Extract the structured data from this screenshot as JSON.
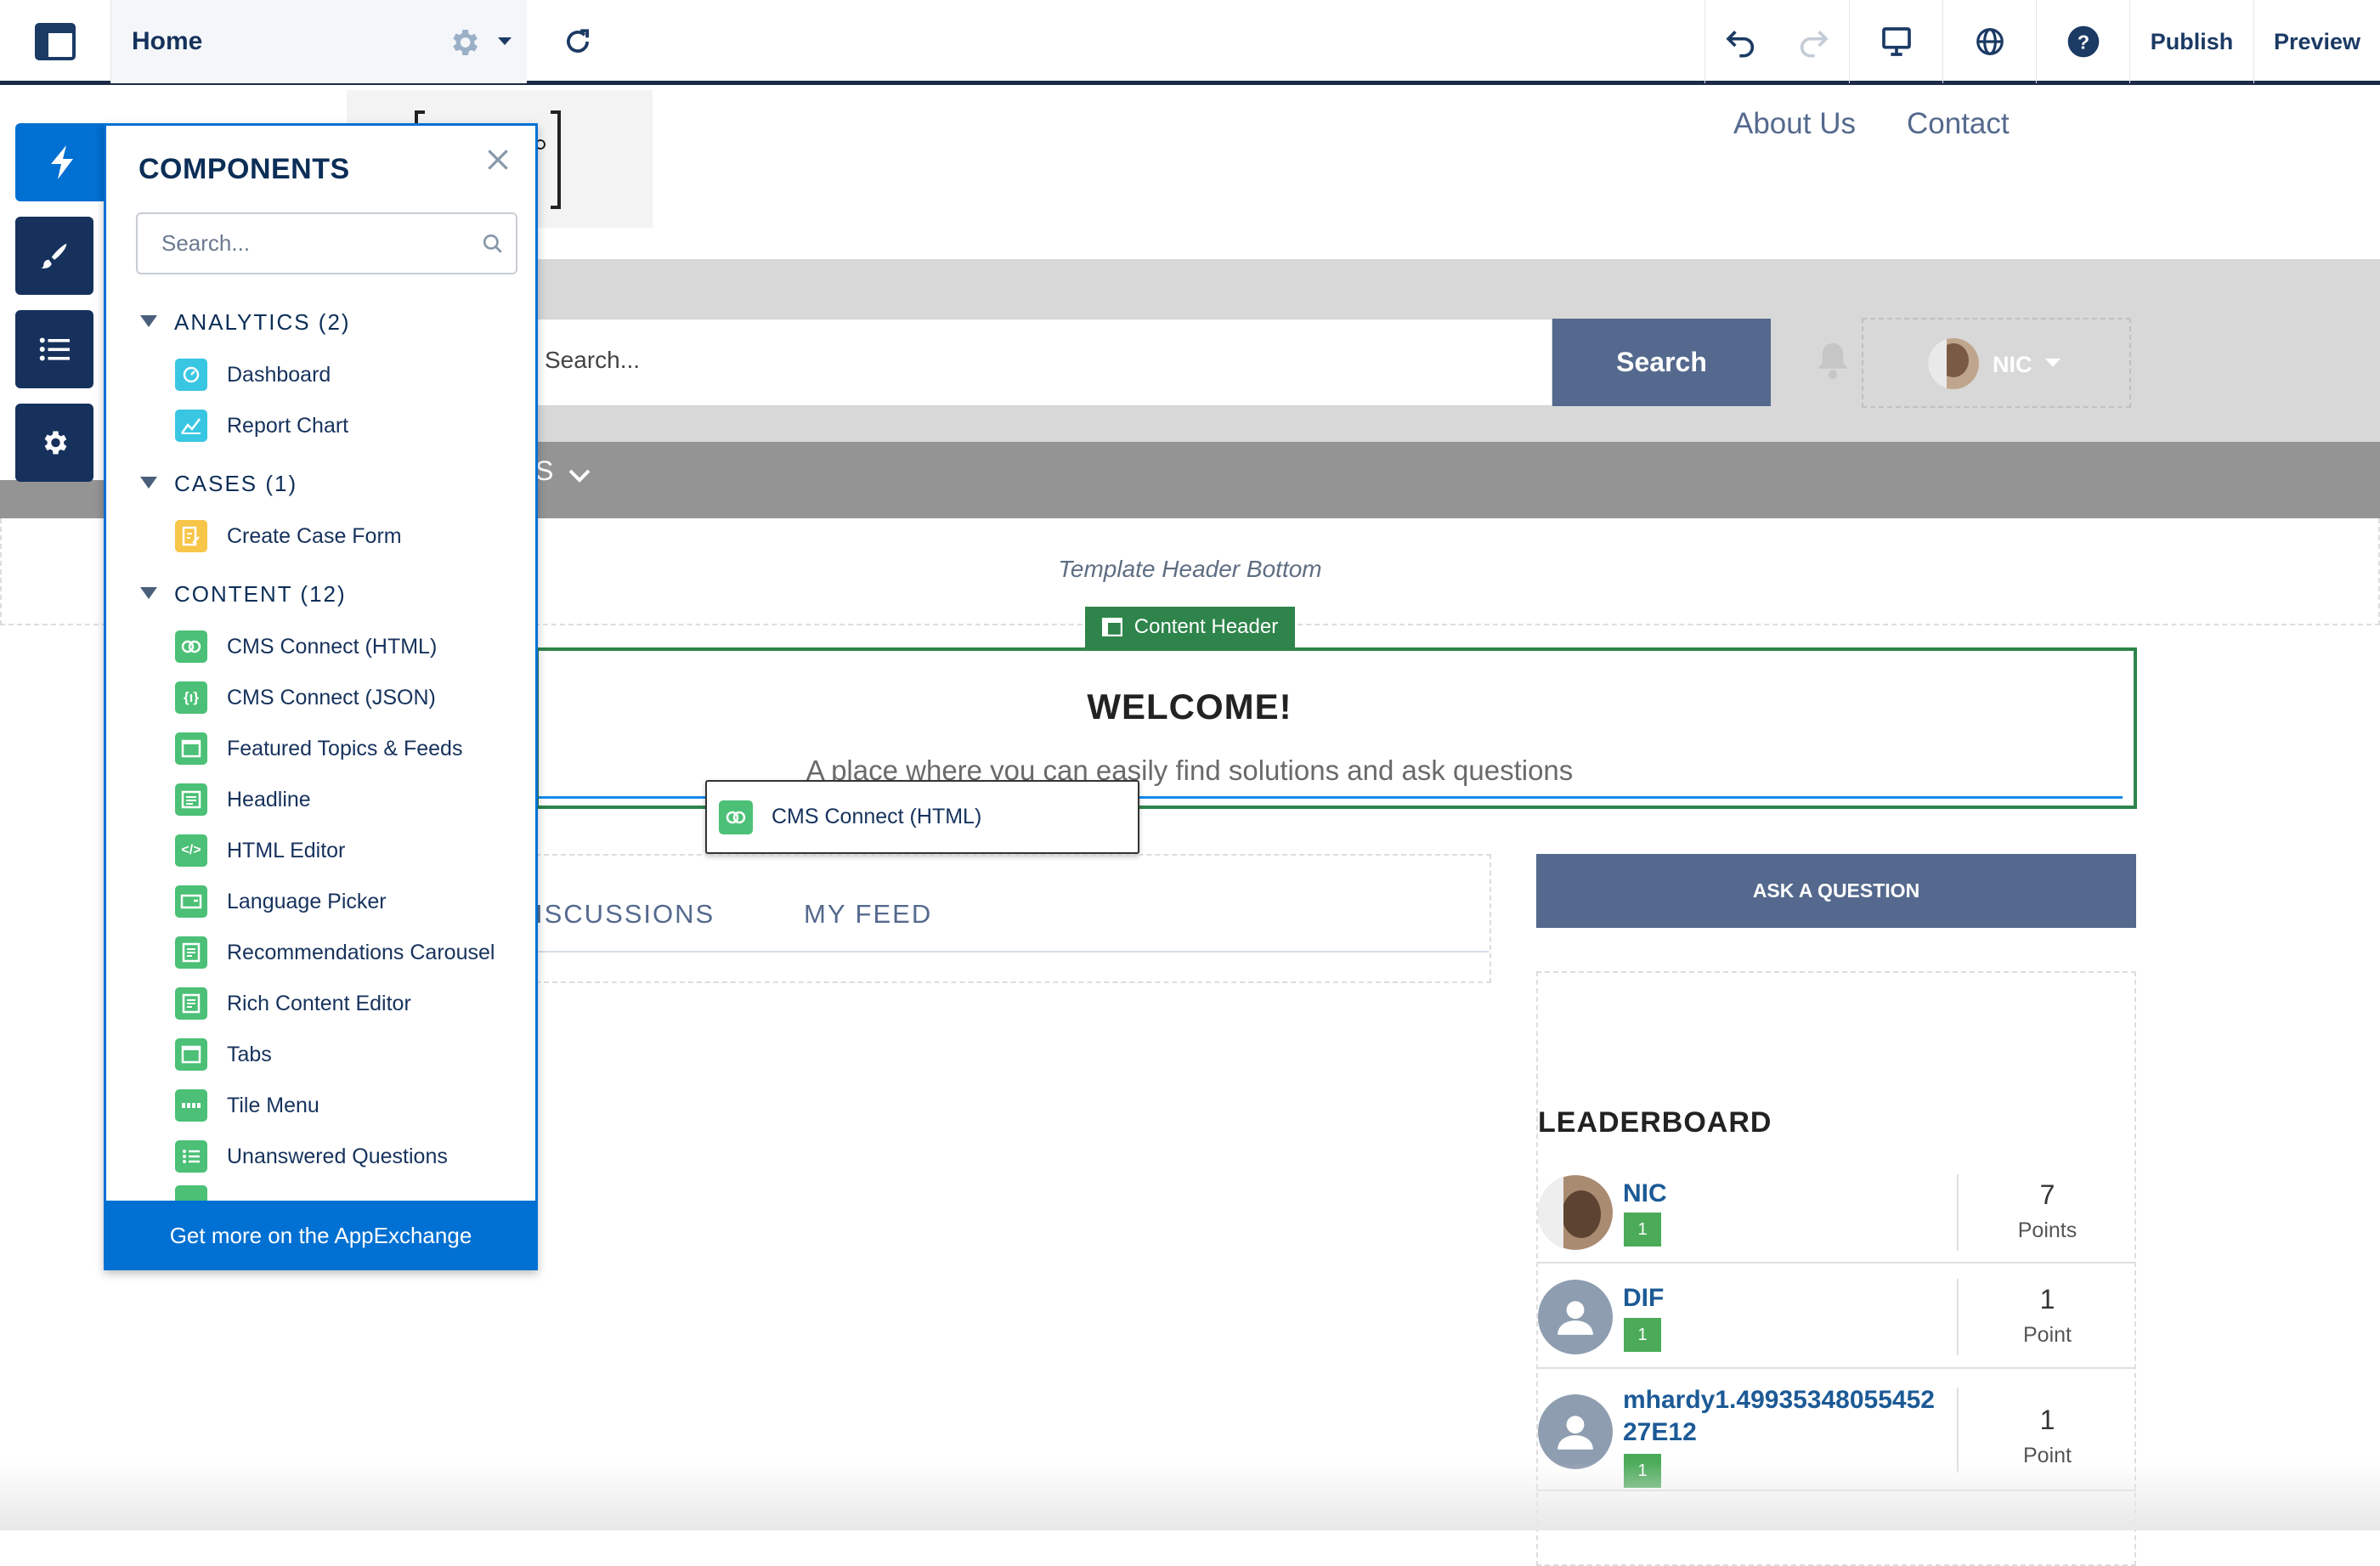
{
  "toolbar": {
    "page_name": "Home",
    "publish": "Publish",
    "preview": "Preview"
  },
  "site_nav": {
    "about": "About Us",
    "contact": "Contact"
  },
  "site_header": {
    "search_placeholder": "Search...",
    "search_button": "Search",
    "user_name": "NIC",
    "nav_partial": "S"
  },
  "template_header_bottom": "Template Header Bottom",
  "content_header": {
    "tag": "Content Header",
    "title": "WELCOME!",
    "subtitle": "A place where you can easily find solutions and ask questions"
  },
  "drag_item": "CMS Connect (HTML)",
  "tabs": {
    "discussions": "ISCUSSIONS",
    "my_feed": "MY FEED"
  },
  "ask_button": "ASK A QUESTION",
  "leaderboard": {
    "title": "LEADERBOARD",
    "rows": [
      {
        "name": "NIC",
        "badge": "1",
        "points": "7",
        "unit": "Points"
      },
      {
        "name": "DIF",
        "badge": "1",
        "points": "1",
        "unit": "Point"
      },
      {
        "name": "mhardy1.4993534805545227E12",
        "name_line1": "mhardy1.49935348055452",
        "name_line2": "27E12",
        "badge": "1",
        "points": "1",
        "unit": "Point"
      }
    ]
  },
  "components": {
    "title": "COMPONENTS",
    "search_placeholder": "Search...",
    "groups": [
      {
        "label": "ANALYTICS (2)",
        "items": [
          {
            "label": "Dashboard",
            "icon": "dashboard-icon"
          },
          {
            "label": "Report Chart",
            "icon": "report-chart-icon"
          }
        ]
      },
      {
        "label": "CASES (1)",
        "items": [
          {
            "label": "Create Case Form",
            "icon": "case-form-icon"
          }
        ]
      },
      {
        "label": "CONTENT (12)",
        "items": [
          {
            "label": "CMS Connect (HTML)",
            "icon": "cms-connect-icon"
          },
          {
            "label": "CMS Connect (JSON)",
            "icon": "json-braces-icon"
          },
          {
            "label": "Featured Topics & Feeds",
            "icon": "tab-frame-icon"
          },
          {
            "label": "Headline",
            "icon": "headline-icon"
          },
          {
            "label": "HTML Editor",
            "icon": "code-icon"
          },
          {
            "label": "Language Picker",
            "icon": "language-picker-icon"
          },
          {
            "label": "Recommendations Carousel",
            "icon": "document-icon"
          },
          {
            "label": "Rich Content Editor",
            "icon": "document-icon"
          },
          {
            "label": "Tabs",
            "icon": "tab-frame-icon"
          },
          {
            "label": "Tile Menu",
            "icon": "tile-menu-icon"
          },
          {
            "label": "Unanswered Questions",
            "icon": "list-icon"
          }
        ]
      }
    ],
    "appexchange": "Get more on the AppExchange"
  },
  "colors": {
    "brand_blue": "#0070d2",
    "navy": "#16325c",
    "green": "#4bc076"
  }
}
